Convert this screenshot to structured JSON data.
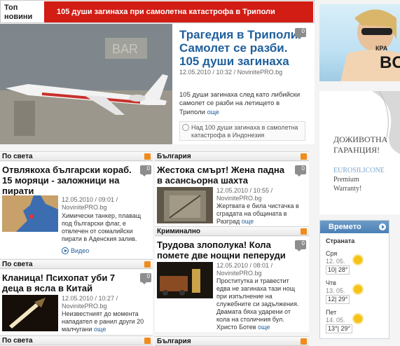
{
  "topbar": {
    "label": "Топ новини",
    "headline": "105 души загинаха при самолетна катастрофа в Триполи"
  },
  "feature": {
    "title": "Трагедия в Триполи! Самолет се разби. 105 души загинаха",
    "comments": "0",
    "meta": "12.05.2010 / 10:32 / NovinitePRO.bg",
    "summary": "105 души загинаха след като либийски самолет се разби на летището в Триполи",
    "more": "още",
    "related": "Над 100 души загинаха в самолетна катастрофа в Индонезия"
  },
  "col_left": [
    {
      "section": "По света",
      "title": "Отвлякоха български кораб. 15 моряци - заложници на пирати",
      "comments": "0",
      "date": "12.05.2010 / 09:01 /",
      "source": "NovinitePRO.bg",
      "summary": "Химически танкер, плаващ под български флаг, е отвлечен от сомалийски пирати в Аденския залив.",
      "video": "Видео"
    },
    {
      "section": "По света",
      "title": "Кланица! Психопат уби 7 деца в ясла в Китай",
      "comments": "0",
      "date": "12.05.2010 / 10:27 /",
      "source": "NovinitePRO.bg",
      "summary": "Неизвестният до момента нападател е ранил други 20 малчугани",
      "more": "още"
    },
    {
      "section": "По света"
    }
  ],
  "col_right": [
    {
      "section": "България",
      "title": "Жестока смърт! Жена падна в асансьорна шахта",
      "comments": "0",
      "date": "12.05.2010 / 10:55 /",
      "source": "NovinitePRO.bg",
      "summary": "Жертвата е била чистачка в сградата на общината в Разград",
      "more": "още"
    },
    {
      "section": "Криминално",
      "title": "Трудова злополука! Кола помете две нощни пеперуди",
      "comments": "0",
      "date": "12.05.2010 / 08:01 /",
      "source": "NovinitePRO.bg",
      "summary": "Проститутка и травестит едва не загинаха тази нощ при изпълнение на служебните си задължения. Двамата бяха ударени от кола на столичния бул. Христо Ботев",
      "more": "още"
    },
    {
      "section": "България"
    }
  ],
  "ad_top": {
    "text_a": "КРА",
    "text_b": "BO"
  },
  "ad_mid": {
    "line1": "ДОЖИВОТНА",
    "line2": "ГАРАНЦИЯ!",
    "brand": "EUROSILICONE",
    "line3": "Premium",
    "line4": "Warranty!"
  },
  "weather": {
    "title": "Времето",
    "country": "Страната",
    "days": [
      {
        "day": "Сря",
        "date": "12. 05.",
        "temps": "10| 28°"
      },
      {
        "day": "Чтв",
        "date": "13. 05.",
        "temps": "12| 29°"
      },
      {
        "day": "Пет",
        "date": "14. 05.",
        "temps": "13°| 29°"
      }
    ]
  },
  "colors": {
    "accent_red": "#d21d15",
    "link_blue": "#1f5f9c",
    "weather_blue": "#4a7fb4"
  }
}
